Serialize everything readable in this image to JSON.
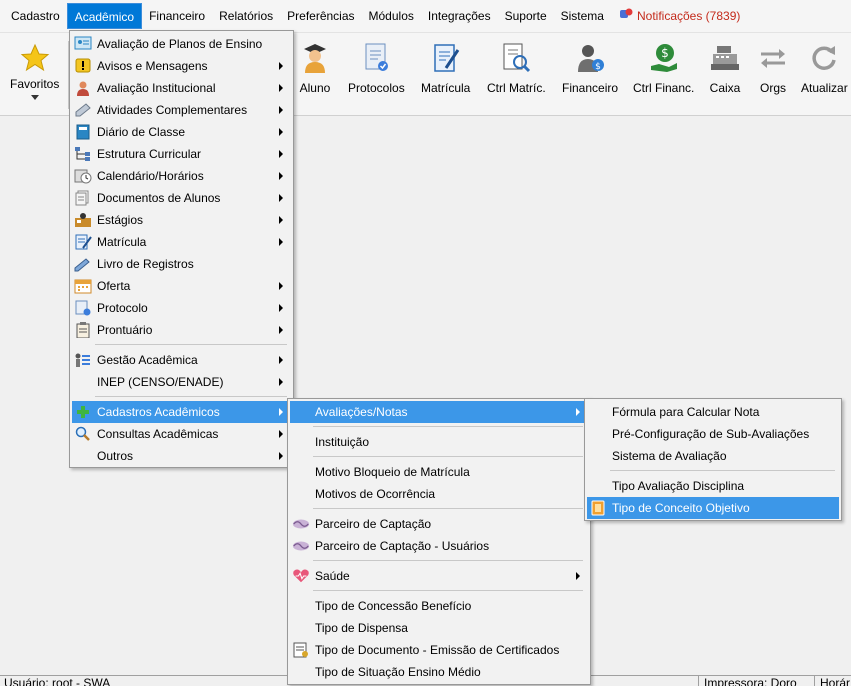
{
  "menubar": {
    "items": [
      "Cadastro",
      "Acadêmico",
      "Financeiro",
      "Relatórios",
      "Preferências",
      "Módulos",
      "Integrações",
      "Suporte",
      "Sistema"
    ],
    "notifications": "Notificações (7839)"
  },
  "toolbar": {
    "favoritos": "Favoritos",
    "aluno": "Aluno",
    "protocolos": "Protocolos",
    "matricula": "Matrícula",
    "ctrl_matric": "Ctrl Matríc.",
    "financeiro": "Financeiro",
    "ctrl_financ": "Ctrl Financ.",
    "caixa": "Caixa",
    "orgs": "Orgs",
    "atualizar": "Atualizar"
  },
  "menu_academico": {
    "items": [
      "Avaliação de Planos de Ensino",
      "Avisos e Mensagens",
      "Avaliação Institucional",
      "Atividades Complementares",
      "Diário de Classe",
      "Estrutura Curricular",
      "Calendário/Horários",
      "Documentos de Alunos",
      "Estágios",
      "Matrícula",
      "Livro de Registros",
      "Oferta",
      "Protocolo",
      "Prontuário",
      "Gestão Acadêmica",
      "INEP (CENSO/ENADE)",
      "Cadastros Acadêmicos",
      "Consultas Acadêmicas",
      "Outros"
    ]
  },
  "menu_cadastros": {
    "items": [
      "Avaliações/Notas",
      "Instituição",
      "Motivo Bloqueio de Matrícula",
      "Motivos de Ocorrência",
      "Parceiro de Captação",
      "Parceiro de Captação - Usuários",
      "Saúde",
      "Tipo de Concessão Benefício",
      "Tipo de Dispensa",
      "Tipo de Documento - Emissão de Certificados",
      "Tipo de Situação Ensino Médio"
    ]
  },
  "menu_avaliacoes": {
    "items": [
      "Fórmula para Calcular Nota",
      "Pré-Configuração de Sub-Avaliações",
      "Sistema de Avaliação",
      "Tipo Avaliação Disciplina",
      "Tipo de Conceito Objetivo"
    ]
  },
  "statusbar": {
    "usuario": "Usuário: root - SWA",
    "impressora": "Impressora: Doro",
    "hora": "Horár"
  },
  "colors": {
    "highlight": "#3c97e8",
    "active_menu": "#0078d7",
    "notification": "#c42b1c"
  }
}
